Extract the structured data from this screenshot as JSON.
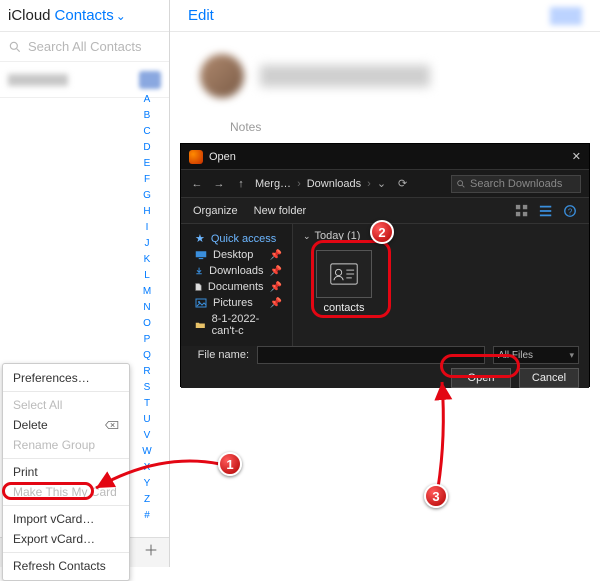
{
  "brand": {
    "app": "iCloud",
    "section": "Contacts"
  },
  "search": {
    "placeholder": "Search All Contacts"
  },
  "alpha": [
    "A",
    "B",
    "C",
    "D",
    "E",
    "F",
    "G",
    "H",
    "I",
    "J",
    "K",
    "L",
    "M",
    "N",
    "O",
    "P",
    "Q",
    "R",
    "S",
    "T",
    "U",
    "V",
    "W",
    "X",
    "Y",
    "Z",
    "#"
  ],
  "main": {
    "edit": "Edit",
    "notes_label": "Notes"
  },
  "context_menu": {
    "preferences": "Preferences…",
    "select_all": "Select All",
    "delete": "Delete",
    "rename_group": "Rename Group",
    "print": "Print",
    "make_my_card": "Make This My Card",
    "import_vcard": "Import vCard…",
    "export_vcard": "Export vCard…",
    "refresh": "Refresh Contacts"
  },
  "dialog": {
    "title": "Open",
    "breadcrumb": [
      "Merg…",
      "Downloads"
    ],
    "search_placeholder": "Search Downloads",
    "organize": "Organize",
    "new_folder": "New folder",
    "tree": {
      "quick": "Quick access",
      "desktop": "Desktop",
      "downloads": "Downloads",
      "documents": "Documents",
      "pictures": "Pictures",
      "folder_recent": "8-1-2022-can't-c"
    },
    "group_header": "Today (1)",
    "file_name": "contacts",
    "file_label": "File name:",
    "filter": "All Files",
    "open": "Open",
    "cancel": "Cancel"
  },
  "markers": {
    "m1": "1",
    "m2": "2",
    "m3": "3"
  }
}
